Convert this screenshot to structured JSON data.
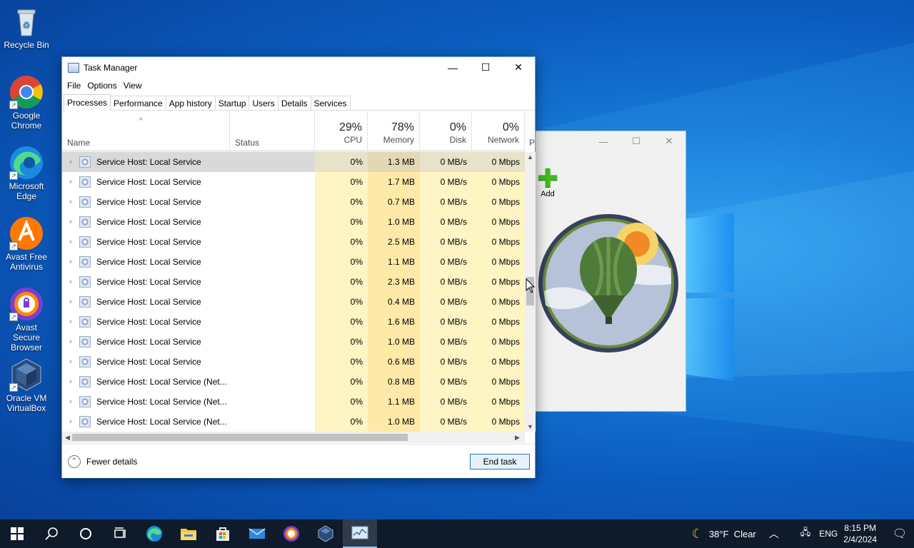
{
  "desktop": {
    "icons": [
      {
        "label": "Recycle Bin",
        "icon": "recycle-bin-icon"
      },
      {
        "label": "Google Chrome",
        "icon": "chrome-icon"
      },
      {
        "label": "Microsoft Edge",
        "icon": "edge-icon"
      },
      {
        "label": "Avast Free Antivirus",
        "icon": "avast-antivirus-icon"
      },
      {
        "label": "Avast Secure Browser",
        "icon": "avast-browser-icon"
      },
      {
        "label": "Oracle VM VirtualBox",
        "icon": "virtualbox-icon"
      }
    ]
  },
  "task_manager": {
    "title": "Task Manager",
    "menu": [
      "File",
      "Options",
      "View"
    ],
    "tabs": [
      "Processes",
      "Performance",
      "App history",
      "Startup",
      "Users",
      "Details",
      "Services"
    ],
    "active_tab": "Processes",
    "columns": {
      "name": "Name",
      "status": "Status",
      "cpu": {
        "percent": "29%",
        "label": "CPU"
      },
      "memory": {
        "percent": "78%",
        "label": "Memory"
      },
      "disk": {
        "percent": "0%",
        "label": "Disk"
      },
      "network": {
        "percent": "0%",
        "label": "Network"
      },
      "power_partial": "P"
    },
    "rows": [
      {
        "name": "Service Host: Local Service",
        "cpu": "0%",
        "memory": "1.3 MB",
        "disk": "0 MB/s",
        "network": "0 Mbps",
        "selected": true
      },
      {
        "name": "Service Host: Local Service",
        "cpu": "0%",
        "memory": "1.7 MB",
        "disk": "0 MB/s",
        "network": "0 Mbps"
      },
      {
        "name": "Service Host: Local Service",
        "cpu": "0%",
        "memory": "0.7 MB",
        "disk": "0 MB/s",
        "network": "0 Mbps"
      },
      {
        "name": "Service Host: Local Service",
        "cpu": "0%",
        "memory": "1.0 MB",
        "disk": "0 MB/s",
        "network": "0 Mbps"
      },
      {
        "name": "Service Host: Local Service",
        "cpu": "0%",
        "memory": "2.5 MB",
        "disk": "0 MB/s",
        "network": "0 Mbps"
      },
      {
        "name": "Service Host: Local Service",
        "cpu": "0%",
        "memory": "1.1 MB",
        "disk": "0 MB/s",
        "network": "0 Mbps"
      },
      {
        "name": "Service Host: Local Service",
        "cpu": "0%",
        "memory": "2.3 MB",
        "disk": "0 MB/s",
        "network": "0 Mbps"
      },
      {
        "name": "Service Host: Local Service",
        "cpu": "0%",
        "memory": "0.4 MB",
        "disk": "0 MB/s",
        "network": "0 Mbps"
      },
      {
        "name": "Service Host: Local Service",
        "cpu": "0%",
        "memory": "1.6 MB",
        "disk": "0 MB/s",
        "network": "0 Mbps"
      },
      {
        "name": "Service Host: Local Service",
        "cpu": "0%",
        "memory": "1.0 MB",
        "disk": "0 MB/s",
        "network": "0 Mbps"
      },
      {
        "name": "Service Host: Local Service",
        "cpu": "0%",
        "memory": "0.6 MB",
        "disk": "0 MB/s",
        "network": "0 Mbps"
      },
      {
        "name": "Service Host: Local Service (Net...",
        "cpu": "0%",
        "memory": "0.8 MB",
        "disk": "0 MB/s",
        "network": "0 Mbps"
      },
      {
        "name": "Service Host: Local Service (Net...",
        "cpu": "0%",
        "memory": "1.1 MB",
        "disk": "0 MB/s",
        "network": "0 Mbps"
      },
      {
        "name": "Service Host: Local Service (Net...",
        "cpu": "0%",
        "memory": "1.0 MB",
        "disk": "0 MB/s",
        "network": "0 Mbps"
      }
    ],
    "fewer_details": "Fewer details",
    "end_task": "End task"
  },
  "photo_app": {
    "add_label": "Add"
  },
  "taskbar": {
    "items": [
      "start-icon",
      "search-icon",
      "cortana-icon",
      "task-view-icon",
      "edge-icon",
      "file-explorer-icon",
      "store-icon",
      "mail-icon",
      "avast-browser-icon",
      "virtualbox-icon",
      "task-manager-icon"
    ],
    "weather": "38°F  Clear",
    "language": "ENG",
    "time": "8:15 PM",
    "date": "2/4/2024"
  }
}
